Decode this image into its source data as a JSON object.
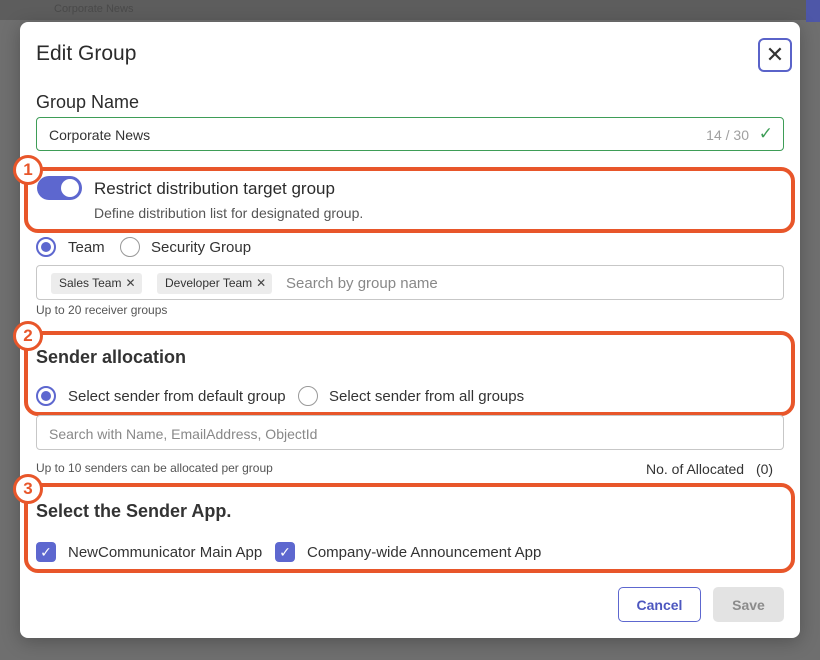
{
  "background": {
    "left_text": "",
    "center_text": "Corporate News"
  },
  "modal": {
    "title": "Edit Group",
    "close_icon": "close-icon"
  },
  "group_name": {
    "label": "Group Name",
    "value": "Corporate News",
    "char_count": "14 / 30",
    "valid_icon": "checkmark-icon"
  },
  "callouts": [
    "1",
    "2",
    "3"
  ],
  "restrict": {
    "enabled": true,
    "title": "Restrict distribution target group",
    "description": "Define distribution list for designated group."
  },
  "group_type": {
    "options": [
      "Team",
      "Security Group"
    ],
    "selected": "Team"
  },
  "receivers": {
    "chips": [
      "Sales Team",
      "Developer Team"
    ],
    "placeholder": "Search by group name",
    "hint": "Up to 20 receiver groups"
  },
  "sender_allocation": {
    "title": "Sender allocation",
    "options": [
      "Select sender from default group",
      "Select sender from all groups"
    ],
    "selected": "Select sender from default group",
    "search_placeholder": "Search with Name, EmailAddress, ObjectId",
    "hint": "Up to 10 senders can be allocated per group",
    "allocated_label": "No. of Allocated",
    "allocated_count": "(0)"
  },
  "sender_app": {
    "title": "Select the Sender App.",
    "apps": [
      {
        "label": "NewCommunicator Main App",
        "checked": true
      },
      {
        "label": "Company-wide Announcement App",
        "checked": true
      }
    ]
  },
  "footer": {
    "cancel_label": "Cancel",
    "save_label": "Save"
  },
  "colors": {
    "accent": "#5d67cf",
    "callout": "#e8562a",
    "valid": "#3e9d57"
  }
}
